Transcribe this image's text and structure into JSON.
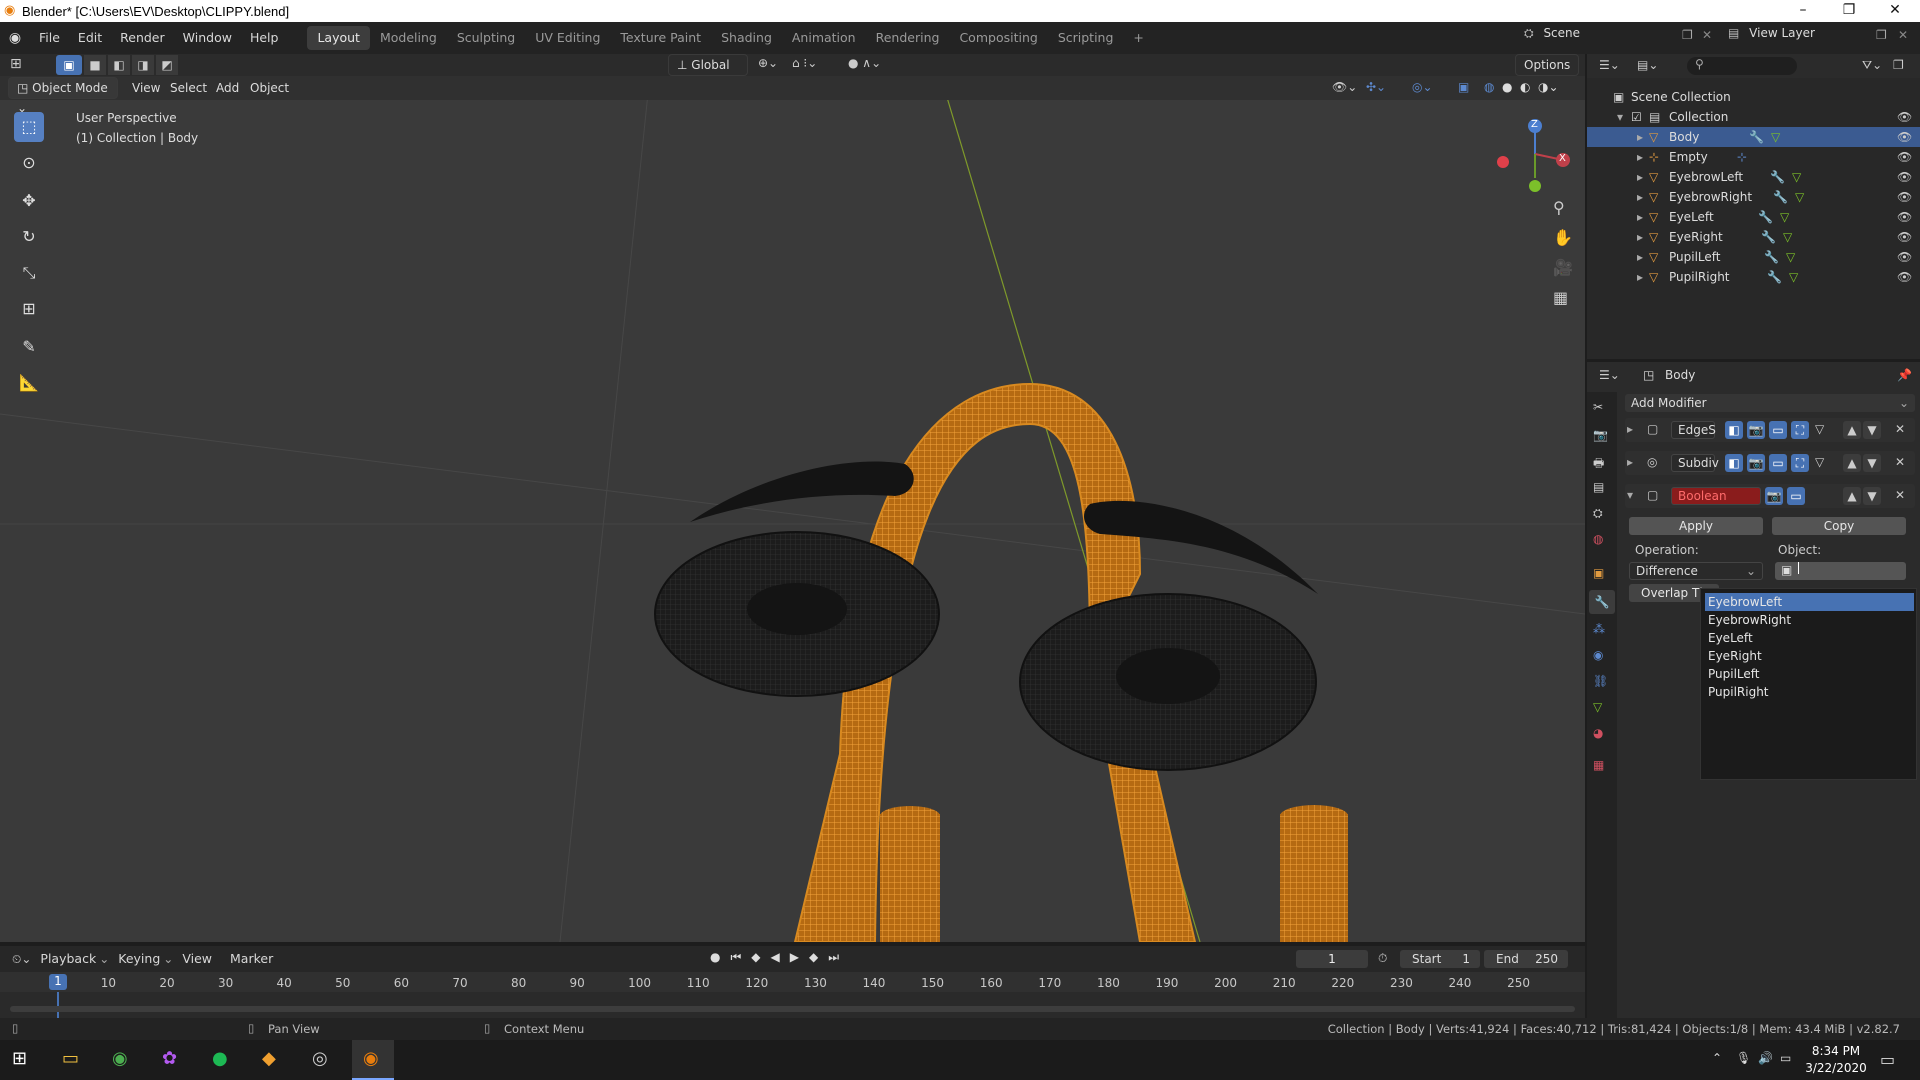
{
  "window": {
    "title": "Blender* [C:\\Users\\EV\\Desktop\\CLIPPY.blend]",
    "min": "–",
    "max": "❐",
    "close": "✕"
  },
  "menus": [
    "File",
    "Edit",
    "Render",
    "Window",
    "Help"
  ],
  "workspaces": [
    "Layout",
    "Modeling",
    "Sculpting",
    "UV Editing",
    "Texture Paint",
    "Shading",
    "Animation",
    "Rendering",
    "Compositing",
    "Scripting"
  ],
  "add_workspace": "+",
  "scene": {
    "label": "Scene",
    "view_layer": "View Layer"
  },
  "viewport": {
    "orientation": "Global",
    "options": "Options",
    "mode": "Object Mode",
    "menus": [
      "View",
      "Select",
      "Add",
      "Object"
    ],
    "info_line1": "User Perspective",
    "info_line2": "(1) Collection | Body",
    "gizmo": {
      "z": "Z",
      "x": "X"
    }
  },
  "outliner": {
    "search_placeholder": "",
    "scene_collection": "Scene Collection",
    "collection": "Collection",
    "items": [
      "Body",
      "Empty",
      "EyebrowLeft",
      "EyebrowRight",
      "EyeLeft",
      "EyeRight",
      "PupilLeft",
      "PupilRight"
    ]
  },
  "properties": {
    "object_name": "Body",
    "add_modifier": "Add Modifier",
    "modifiers": [
      "EdgeS",
      "Subdiv",
      "Boolean"
    ],
    "apply": "Apply",
    "copy": "Copy",
    "operation_label": "Operation:",
    "object_label": "Object:",
    "operation_value": "Difference",
    "overlap": "Overlap Th"
  },
  "dropdown": {
    "items": [
      "EyebrowLeft",
      "EyebrowRight",
      "EyeLeft",
      "EyeRight",
      "PupilLeft",
      "PupilRight"
    ]
  },
  "timeline": {
    "menus": [
      "Playback",
      "Keying",
      "View",
      "Marker"
    ],
    "current": "1",
    "start_label": "Start",
    "start": "1",
    "end_label": "End",
    "end": "250",
    "ticks": [
      "1",
      "10",
      "20",
      "30",
      "40",
      "50",
      "60",
      "70",
      "80",
      "90",
      "100",
      "110",
      "120",
      "130",
      "140",
      "150",
      "160",
      "170",
      "180",
      "190",
      "200",
      "210",
      "220",
      "230",
      "240",
      "250"
    ]
  },
  "status": {
    "pan": "Pan View",
    "context": "Context Menu",
    "stats": "Collection | Body | Verts:41,924 | Faces:40,712 | Tris:81,424 | Objects:1/8 | Mem: 43.4 MiB | v2.82.7"
  },
  "taskbar": {
    "time": "8:34 PM",
    "date": "3/22/2020"
  }
}
